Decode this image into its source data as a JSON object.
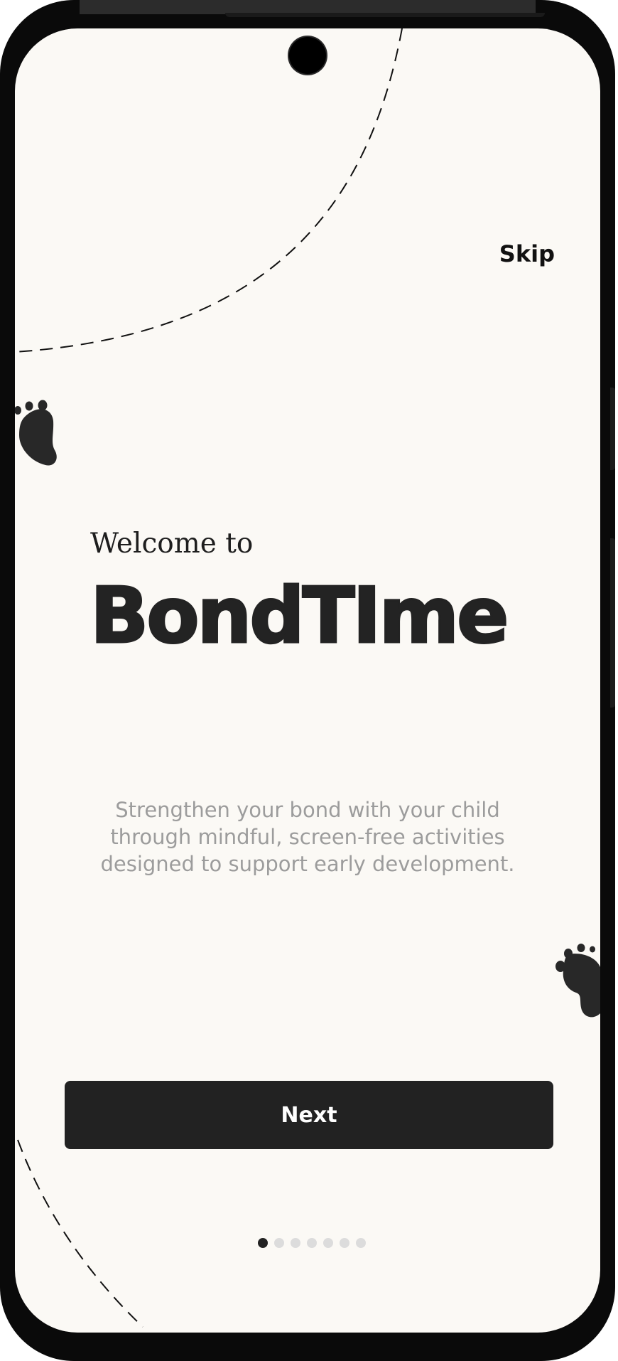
{
  "app": {
    "name": "BondTIme"
  },
  "header": {
    "skip_label": "Skip"
  },
  "hero": {
    "welcome": "Welcome to",
    "brand": "BondTIme",
    "tagline": "Strengthen your bond with your child through mindful, screen-free activities designed to support early development."
  },
  "actions": {
    "next_label": "Next"
  },
  "pager": {
    "total": 7,
    "current": 1
  },
  "colors": {
    "background": "#fbf9f5",
    "primary": "#222222",
    "text_muted": "#9c9c9c",
    "dot_inactive": "#dcdcdc"
  },
  "icons": [
    "footprint-icon",
    "footprint-icon"
  ]
}
